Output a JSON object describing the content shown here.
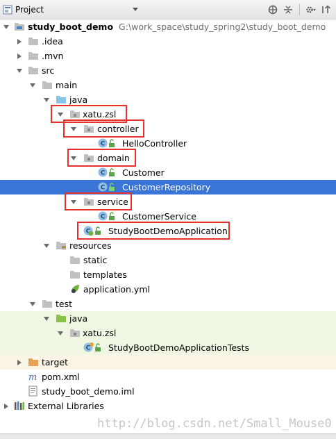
{
  "toolbar": {
    "project_label": "Project",
    "icons": [
      "project-icon",
      "dropdown-icon",
      "sync-icon",
      "collapse-icon",
      "gear-icon",
      "hide-icon"
    ]
  },
  "tree": {
    "root": {
      "label": "study_boot_demo",
      "path": "G:\\work_space\\study_spring2\\study_boot_demo"
    },
    "idea": ".idea",
    "mvn": ".mvn",
    "src": "src",
    "main": "main",
    "java": "java",
    "pkg": "xatu.zsl",
    "controller": "controller",
    "hello_controller": "HelloController",
    "domain": "domain",
    "customer": "Customer",
    "customer_repository": "CustomerRepository",
    "service": "service",
    "customer_service": "CustomerService",
    "app": "StudyBootDemoApplication",
    "resources": "resources",
    "static": "static",
    "templates": "templates",
    "app_yml": "application.yml",
    "test": "test",
    "test_java": "java",
    "test_pkg": "xatu.zsl",
    "app_tests": "StudyBootDemoApplicationTests",
    "target": "target",
    "pom": "pom.xml",
    "iml": "study_boot_demo.iml",
    "ext_libs": "External Libraries"
  },
  "selected_item": "CustomerRepository",
  "colors": {
    "selection": "#3875d7",
    "highlight_box": "#e8312f",
    "test_bg": "#eff7e3",
    "folder": "#c0c0c0",
    "source_folder": "#87c4e8",
    "test_folder": "#8bc34a",
    "target_folder": "#e8a254",
    "class_icon": "#8fbde4"
  },
  "watermark": "http://blog.csdn.net/Small_Mouse0"
}
